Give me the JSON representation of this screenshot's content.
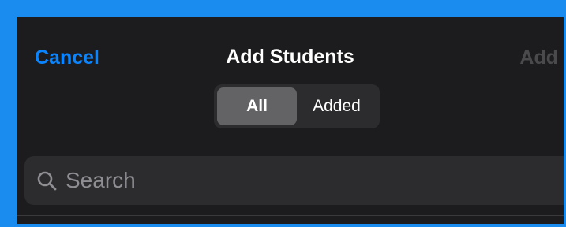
{
  "nav": {
    "cancel_label": "Cancel",
    "title": "Add Students",
    "add_label": "Add"
  },
  "filter": {
    "options": [
      {
        "label": "All",
        "selected": true
      },
      {
        "label": "Added",
        "selected": false
      }
    ]
  },
  "search": {
    "placeholder": "Search",
    "value": ""
  },
  "colors": {
    "accent": "#0a84ff",
    "background": "#1c1c1e",
    "frame": "#1a8cf0",
    "disabled": "#4a4a4c"
  }
}
